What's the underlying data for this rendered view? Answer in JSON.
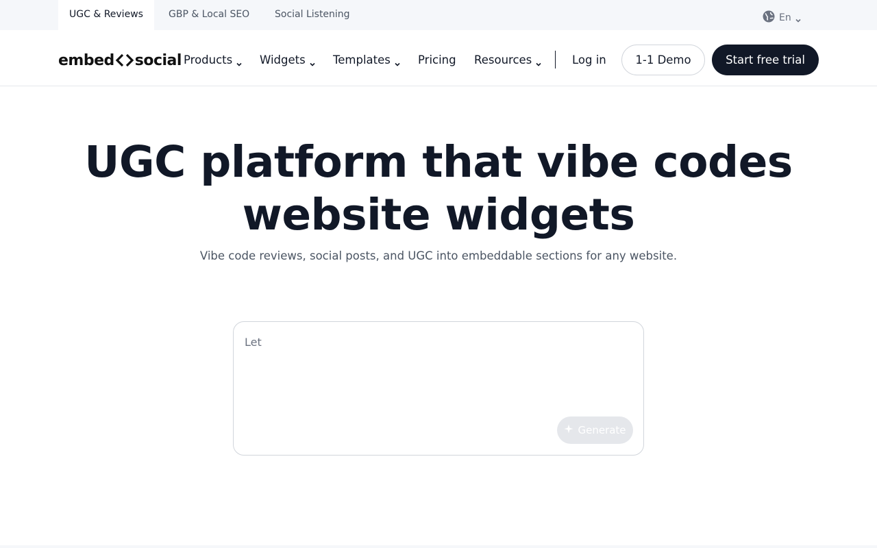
{
  "topbar": {
    "tabs": [
      {
        "label": "UGC & Reviews",
        "active": true
      },
      {
        "label": "GBP & Local SEO",
        "active": false
      },
      {
        "label": "Social Listening",
        "active": false
      }
    ],
    "language": {
      "label": "En",
      "icon": "globe-icon"
    }
  },
  "nav": {
    "logo": {
      "left": "embed",
      "right": "social"
    },
    "items": [
      {
        "label": "Products",
        "dropdown": true
      },
      {
        "label": "Widgets",
        "dropdown": true
      },
      {
        "label": "Templates",
        "dropdown": true
      },
      {
        "label": "Pricing",
        "dropdown": false
      },
      {
        "label": "Resources",
        "dropdown": true
      }
    ],
    "login": "Log in",
    "demo": "1-1 Demo",
    "trial": "Start free trial"
  },
  "hero": {
    "title_line1": "UGC platform that vibe codes",
    "title_line2": "website widgets",
    "subtitle": "Vibe code reviews, social posts, and UGC into embeddable sections for any website."
  },
  "prompt": {
    "text": "Let",
    "generate_label": "Generate",
    "generate_icon": "sparkle-icon"
  },
  "colors": {
    "primary_dark": "#111827",
    "topbar_bg": "#f5f7fa",
    "muted_text": "#4b5563",
    "disabled_btn": "#e5e7eb"
  }
}
